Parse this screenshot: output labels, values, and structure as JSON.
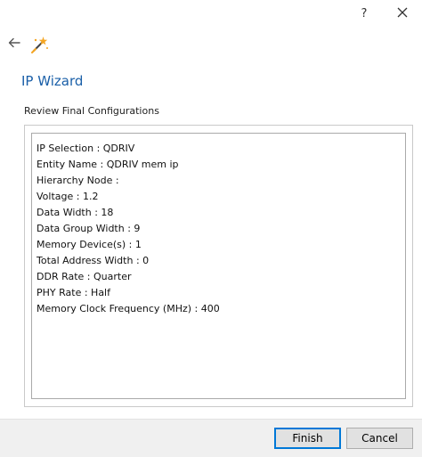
{
  "titlebar": {
    "help_label": "?",
    "close_label": "✕"
  },
  "header": {
    "title": "IP Wizard"
  },
  "review": {
    "section_label": "Review Final Configurations",
    "lines": [
      "IP Selection : QDRIV",
      "Entity Name : QDRIV mem ip",
      "Hierarchy Node :",
      "Voltage : 1.2",
      "Data Width : 18",
      "Data Group Width : 9",
      "Memory Device(s) : 1",
      "Total Address Width : 0",
      "DDR Rate : Quarter",
      "PHY Rate : Half",
      "Memory Clock Frequency (MHz) : 400"
    ]
  },
  "footer": {
    "finish_label": "Finish",
    "cancel_label": "Cancel"
  },
  "colors": {
    "title": "#1a5fa8",
    "default_button_border": "#0078d7",
    "icon_orange": "#f5a623"
  },
  "icons": {
    "back": "arrow-left-icon",
    "app": "wizard-wand-icon"
  }
}
